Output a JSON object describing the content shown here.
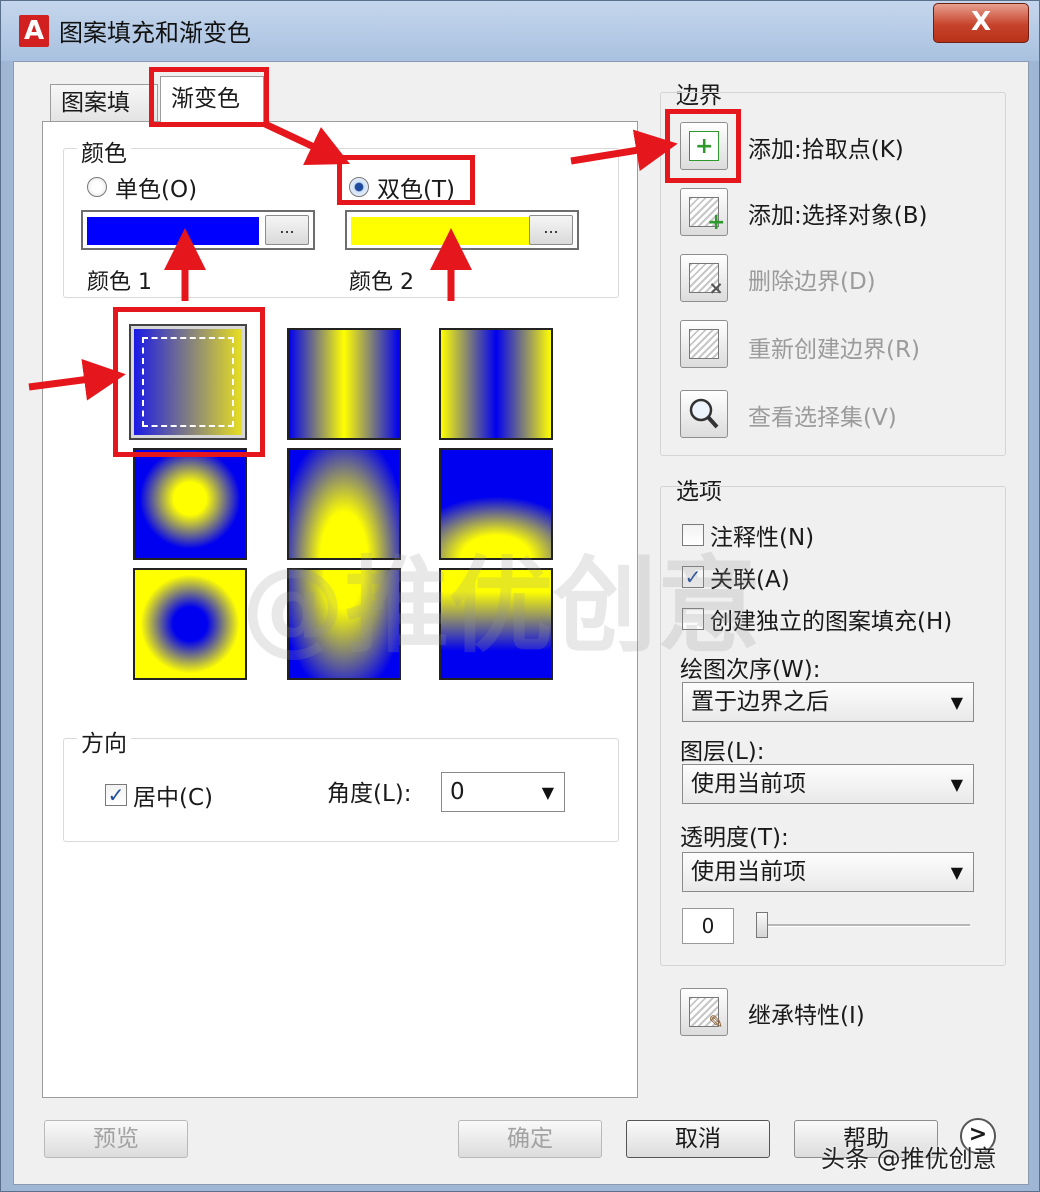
{
  "window": {
    "title": "图案填充和渐变色",
    "app_icon_letter": "A",
    "close_label": "X"
  },
  "tabs": [
    {
      "label": "图案填充"
    },
    {
      "label": "渐变色"
    }
  ],
  "color": {
    "group_label": "颜色",
    "single": "单色(O)",
    "two": "双色(T)",
    "ellipsis": "...",
    "color1_label": "颜色 1",
    "color2_label": "颜色 2",
    "color1_hex": "#0000ff",
    "color2_hex": "#ffff00",
    "selected_mode": "双色(T)"
  },
  "direction": {
    "group_label": "方向",
    "centered_label": "居中(C)",
    "centered_checked": true,
    "angle_label": "角度(L):",
    "angle_value": "0"
  },
  "boundary": {
    "title": "边界",
    "buttons": [
      {
        "label": "添加:拾取点(K)",
        "icon": "pick-points-icon",
        "enabled": true
      },
      {
        "label": "添加:选择对象(B)",
        "icon": "select-objects-icon",
        "enabled": true
      },
      {
        "label": "删除边界(D)",
        "icon": "remove-boundary-icon",
        "enabled": false
      },
      {
        "label": "重新创建边界(R)",
        "icon": "recreate-boundary-icon",
        "enabled": false
      },
      {
        "label": "查看选择集(V)",
        "icon": "magnifier-icon",
        "enabled": false
      }
    ]
  },
  "options": {
    "title": "选项",
    "annotative": {
      "label": "注释性(N)",
      "checked": false
    },
    "associative": {
      "label": "关联(A)",
      "checked": true
    },
    "separate": {
      "label": "创建独立的图案填充(H)",
      "checked": false
    },
    "draw_order_label": "绘图次序(W):",
    "draw_order_value": "置于边界之后",
    "layer_label": "图层(L):",
    "layer_value": "使用当前项",
    "transparency_label": "透明度(T):",
    "transparency_value": "使用当前项",
    "transparency_number": "0",
    "transparency_level": 0
  },
  "inherit": {
    "label": "继承特性(I)"
  },
  "footer": {
    "preview": "预览",
    "ok": "确定",
    "cancel": "取消",
    "help": "帮助",
    "expand": ">"
  },
  "watermark": {
    "text": "@推优创意",
    "footer_mark": "头条 @推优创意"
  },
  "check_glyph": "✓",
  "arrow_glyph": "▼"
}
